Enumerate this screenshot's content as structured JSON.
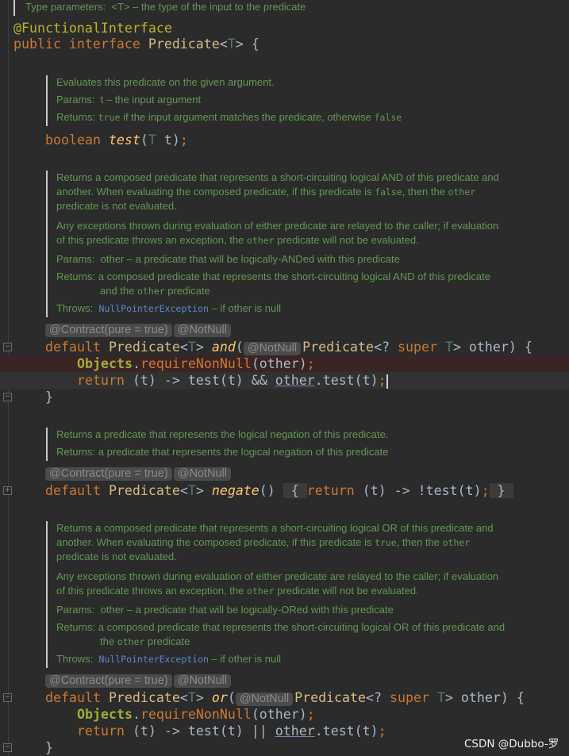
{
  "editor": {
    "language": "java",
    "theme_colors": {
      "background": "#2b2b2b",
      "keyword": "#cc7832",
      "annotation": "#bbb529",
      "doc": "#629755",
      "method": "#ffc66d"
    },
    "rows": [
      {
        "kind": "doc",
        "lines": [
          [
            {
              "t": "Type parameters:  <T> – the type of the input to the predicate"
            }
          ]
        ]
      },
      {
        "kind": "code",
        "segs": [
          {
            "t": "@FunctionalInterface",
            "c": "ann"
          }
        ]
      },
      {
        "kind": "code",
        "segs": [
          {
            "t": "public interface ",
            "c": "kw"
          },
          {
            "t": "Predicate",
            "c": "cls"
          },
          {
            "t": "<",
            "c": ""
          },
          {
            "t": "T",
            "c": "tp"
          },
          {
            "t": "> {",
            "c": ""
          }
        ]
      },
      {
        "kind": "doc",
        "lines": [
          [
            {
              "t": "Evaluates this predicate on the given argument."
            }
          ],
          [
            {
              "t": "Params:  t – the input argument"
            }
          ],
          [
            {
              "t": "Returns: "
            },
            {
              "t": "true",
              "c": "code"
            },
            {
              "t": " if the input argument matches the predicate, otherwise "
            },
            {
              "t": "false",
              "c": "code"
            }
          ]
        ]
      },
      {
        "kind": "code",
        "segs": [
          {
            "t": "boolean ",
            "c": "kw"
          },
          {
            "t": "test",
            "c": "fn"
          },
          {
            "t": "(",
            "c": ""
          },
          {
            "t": "T",
            "c": "tp"
          },
          {
            "t": " t)",
            "c": ""
          },
          {
            "t": ";",
            "c": "kw"
          }
        ]
      },
      {
        "kind": "doc",
        "lines": [
          [
            {
              "t": "Returns a composed predicate that represents a short-circuiting logical AND of this predicate and"
            }
          ],
          [
            {
              "t": "another. When evaluating the composed predicate, if this predicate is "
            },
            {
              "t": "false",
              "c": "code"
            },
            {
              "t": ", then the "
            },
            {
              "t": "other",
              "c": "code"
            }
          ],
          [
            {
              "t": "predicate is not evaluated."
            }
          ],
          [
            {
              "t": "Any exceptions thrown during evaluation of either predicate are relayed to the caller; if evaluation"
            }
          ],
          [
            {
              "t": "of this predicate throws an exception, the "
            },
            {
              "t": "other",
              "c": "code"
            },
            {
              "t": " predicate will not be evaluated."
            }
          ],
          [
            {
              "t": "Params:  other – a predicate that will be logically-ANDed with this predicate"
            }
          ],
          [
            {
              "t": "Returns: a composed predicate that represents the short-circuiting logical AND of this predicate"
            }
          ],
          [
            {
              "t": "and the "
            },
            {
              "t": "other",
              "c": "code"
            },
            {
              "t": " predicate"
            }
          ],
          [
            {
              "t": "Throws:  "
            },
            {
              "t": "NullPointerException",
              "c": "link"
            },
            {
              "t": " – if other is null"
            }
          ]
        ]
      },
      {
        "kind": "hints",
        "items": [
          "@Contract(pure = true)",
          "@NotNull"
        ]
      },
      {
        "kind": "code",
        "segs": [
          {
            "t": "default ",
            "c": "kw"
          },
          {
            "t": "Predicate",
            "c": "cls"
          },
          {
            "t": "<",
            "c": ""
          },
          {
            "t": "T",
            "c": "tp"
          },
          {
            "t": "> ",
            "c": ""
          },
          {
            "t": "and",
            "c": "fn"
          },
          {
            "t": "(",
            "c": ""
          },
          {
            "t": "@NotNull",
            "c": "hint"
          },
          {
            "t": "Predicate",
            "c": "cls"
          },
          {
            "t": "<? ",
            "c": ""
          },
          {
            "t": "super ",
            "c": "kw"
          },
          {
            "t": "T",
            "c": "tp"
          },
          {
            "t": "> other) {",
            "c": ""
          }
        ]
      },
      {
        "kind": "code",
        "segs": [
          {
            "t": "Objects",
            "c": "obj"
          },
          {
            "t": ".",
            "c": ""
          },
          {
            "t": "requireNonNull",
            "c": "kw"
          },
          {
            "t": "(other)",
            "c": ""
          },
          {
            "t": ";",
            "c": "kw"
          }
        ]
      },
      {
        "kind": "code",
        "segs": [
          {
            "t": "return ",
            "c": "kw"
          },
          {
            "t": "(t) -> test(t) && ",
            "c": ""
          },
          {
            "t": "other",
            "c": "fld"
          },
          {
            "t": ".test(t)",
            "c": ""
          },
          {
            "t": ";",
            "c": "kw"
          },
          {
            "t": "",
            "c": "cursor"
          }
        ]
      },
      {
        "kind": "code",
        "segs": [
          {
            "t": "}",
            "c": ""
          }
        ]
      },
      {
        "kind": "doc",
        "lines": [
          [
            {
              "t": "Returns a predicate that represents the logical negation of this predicate."
            }
          ],
          [
            {
              "t": "Returns: a predicate that represents the logical negation of this predicate"
            }
          ]
        ]
      },
      {
        "kind": "hints",
        "items": [
          "@Contract(pure = true)",
          "@NotNull"
        ]
      },
      {
        "kind": "code",
        "segs": [
          {
            "t": "default ",
            "c": "kw"
          },
          {
            "t": "Predicate",
            "c": "cls"
          },
          {
            "t": "<",
            "c": ""
          },
          {
            "t": "T",
            "c": "tp"
          },
          {
            "t": "> ",
            "c": ""
          },
          {
            "t": "negate",
            "c": "fn"
          },
          {
            "t": "() ",
            "c": ""
          },
          {
            "t": " { ",
            "c": "fold"
          },
          {
            "t": "return ",
            "c": "kw"
          },
          {
            "t": "(t) -> !test(t)",
            "c": ""
          },
          {
            "t": ";",
            "c": "kw"
          },
          {
            "t": " } ",
            "c": "fold"
          }
        ]
      },
      {
        "kind": "doc",
        "lines": [
          [
            {
              "t": "Returns a composed predicate that represents a short-circuiting logical OR of this predicate and"
            }
          ],
          [
            {
              "t": "another. When evaluating the composed predicate, if this predicate is "
            },
            {
              "t": "true",
              "c": "code"
            },
            {
              "t": ", then the "
            },
            {
              "t": "other",
              "c": "code"
            }
          ],
          [
            {
              "t": "predicate is not evaluated."
            }
          ],
          [
            {
              "t": "Any exceptions thrown during evaluation of either predicate are relayed to the caller; if evaluation"
            }
          ],
          [
            {
              "t": "of this predicate throws an exception, the "
            },
            {
              "t": "other",
              "c": "code"
            },
            {
              "t": " predicate will not be evaluated."
            }
          ],
          [
            {
              "t": "Params:  other – a predicate that will be logically-ORed with this predicate"
            }
          ],
          [
            {
              "t": "Returns: a composed predicate that represents the short-circuiting logical OR of this predicate and"
            }
          ],
          [
            {
              "t": "the "
            },
            {
              "t": "other",
              "c": "code"
            },
            {
              "t": " predicate"
            }
          ],
          [
            {
              "t": "Throws:  "
            },
            {
              "t": "NullPointerException",
              "c": "link"
            },
            {
              "t": " – if other is null"
            }
          ]
        ]
      },
      {
        "kind": "hints",
        "items": [
          "@Contract(pure = true)",
          "@NotNull"
        ]
      },
      {
        "kind": "code",
        "segs": [
          {
            "t": "default ",
            "c": "kw"
          },
          {
            "t": "Predicate",
            "c": "cls"
          },
          {
            "t": "<",
            "c": ""
          },
          {
            "t": "T",
            "c": "tp"
          },
          {
            "t": "> ",
            "c": ""
          },
          {
            "t": "or",
            "c": "fn"
          },
          {
            "t": "(",
            "c": ""
          },
          {
            "t": "@NotNull",
            "c": "hint"
          },
          {
            "t": "Predicate",
            "c": "cls"
          },
          {
            "t": "<? ",
            "c": ""
          },
          {
            "t": "super ",
            "c": "kw"
          },
          {
            "t": "T",
            "c": "tp"
          },
          {
            "t": "> other) {",
            "c": ""
          }
        ]
      },
      {
        "kind": "code",
        "segs": [
          {
            "t": "Objects",
            "c": "obj"
          },
          {
            "t": ".",
            "c": ""
          },
          {
            "t": "requireNonNull",
            "c": "kw"
          },
          {
            "t": "(other)",
            "c": ""
          },
          {
            "t": ";",
            "c": "kw"
          }
        ]
      },
      {
        "kind": "code",
        "segs": [
          {
            "t": "return ",
            "c": "kw"
          },
          {
            "t": "(t) -> test(t) || ",
            "c": ""
          },
          {
            "t": "other",
            "c": "fld"
          },
          {
            "t": ".test(t)",
            "c": ""
          },
          {
            "t": ";",
            "c": "kw"
          }
        ]
      },
      {
        "kind": "code",
        "segs": [
          {
            "t": "}",
            "c": ""
          }
        ]
      }
    ]
  },
  "watermark": "CSDN @Dubbo-罗"
}
